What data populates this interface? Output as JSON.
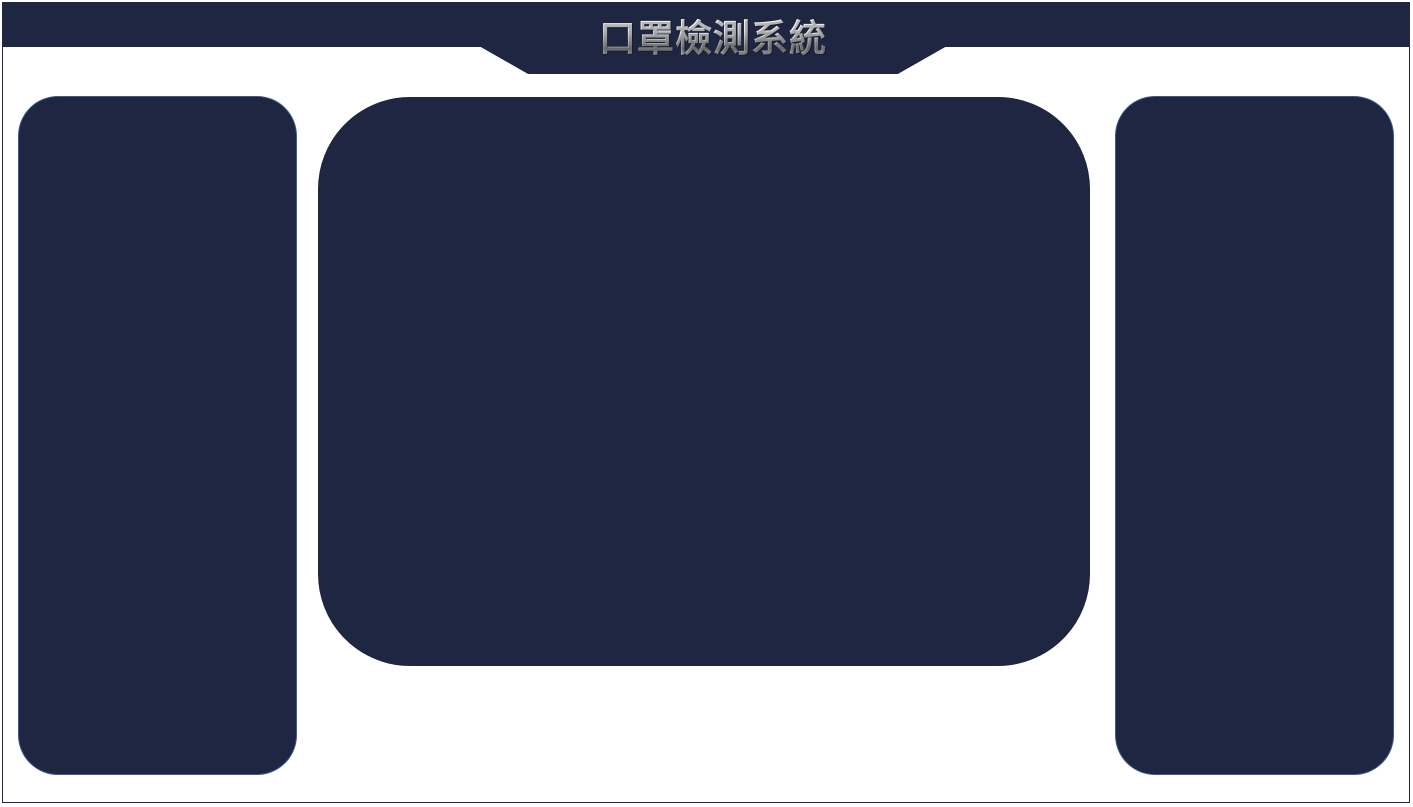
{
  "app": {
    "title": "口罩檢測系統"
  },
  "colors": {
    "background": "#ffffff",
    "panel": "#1e2642",
    "panel_border": "#3d5a8a",
    "title_text": "#d7d7d7"
  }
}
